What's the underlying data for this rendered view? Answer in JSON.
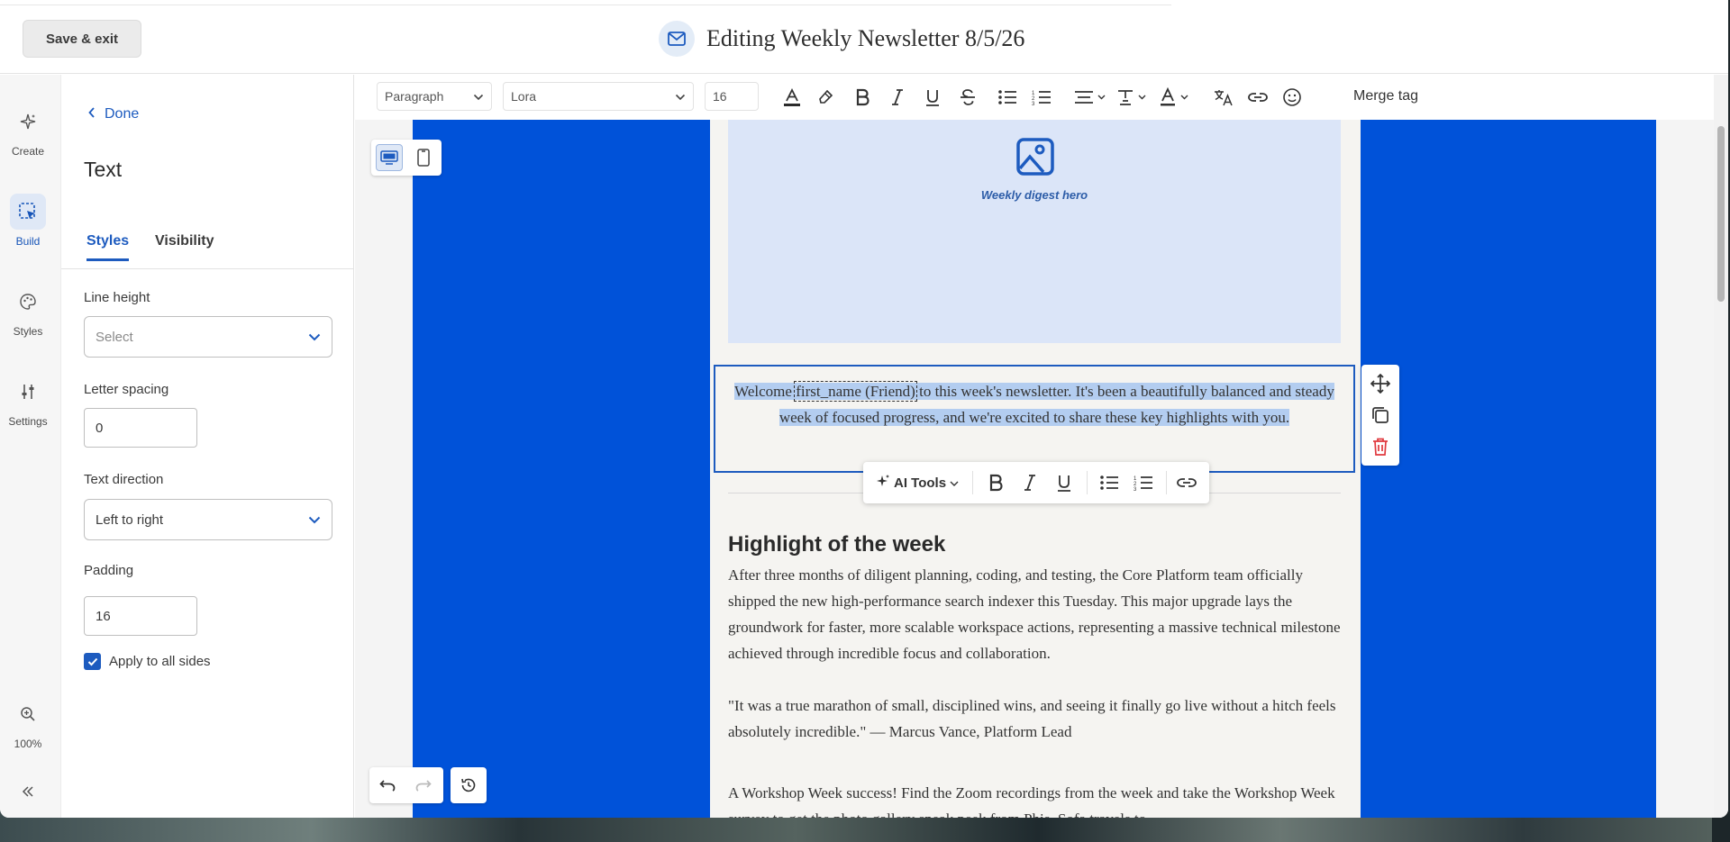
{
  "header": {
    "save_exit_label": "Save & exit",
    "title": "Editing Weekly Newsletter 8/5/26"
  },
  "rail": {
    "items": [
      {
        "label": "Create",
        "icon": "sparkle-icon"
      },
      {
        "label": "Build",
        "icon": "build-select-icon",
        "active": true
      },
      {
        "label": "Styles",
        "icon": "palette-icon"
      },
      {
        "label": "Settings",
        "icon": "sliders-icon"
      }
    ],
    "zoom_label": "100%"
  },
  "panel": {
    "done_label": "Done",
    "title": "Text",
    "tabs": [
      {
        "label": "Styles",
        "active": true
      },
      {
        "label": "Visibility",
        "active": false
      }
    ],
    "line_height": {
      "label": "Line height",
      "placeholder": "Select"
    },
    "letter_spacing": {
      "label": "Letter spacing",
      "value": "0"
    },
    "text_direction": {
      "label": "Text direction",
      "value": "Left to right"
    },
    "padding": {
      "label": "Padding",
      "value": "16"
    },
    "apply_all_sides": {
      "label": "Apply to all sides",
      "checked": true
    }
  },
  "toolbar": {
    "block_type": "Paragraph",
    "font": "Lora",
    "font_size": "16",
    "merge_tag_label": "Merge tag"
  },
  "email": {
    "hero_caption": "Weekly digest hero",
    "intro": {
      "before": "Welcome ",
      "merge_tag": "first_name (Friend)",
      "after": " to this week's newsletter. It's been a beautifully balanced and steady week of focused progress, and we're excited to share these key highlights with you."
    },
    "heading": "Highlight of the week",
    "paragraph1": "After three months of diligent planning, coding, and testing, the Core Platform team officially shipped the new high-performance search indexer this Tuesday. This major upgrade lays the groundwork for faster, more scalable workspace actions, representing a massive technical milestone achieved through incredible focus and collaboration.",
    "paragraph2": "\"It was a true marathon of small, disciplined wins, and seeing it finally go live without a hitch feels absolutely incredible.\" — Marcus Vance, Platform Lead",
    "paragraph3": "A Workshop Week success!  Find the Zoom recordings from the week and take the Workshop Week survey to get the photo gallery sneak peek from Phis, Sofa travels to"
  },
  "floating_toolbar": {
    "ai_tools_label": "AI Tools"
  },
  "colors": {
    "accent": "#1d5bbf",
    "canvas_bg": "#0052d9",
    "email_bg": "#f5f4f1",
    "hero_bg": "#dbe5f8",
    "delete": "#e0393e"
  }
}
